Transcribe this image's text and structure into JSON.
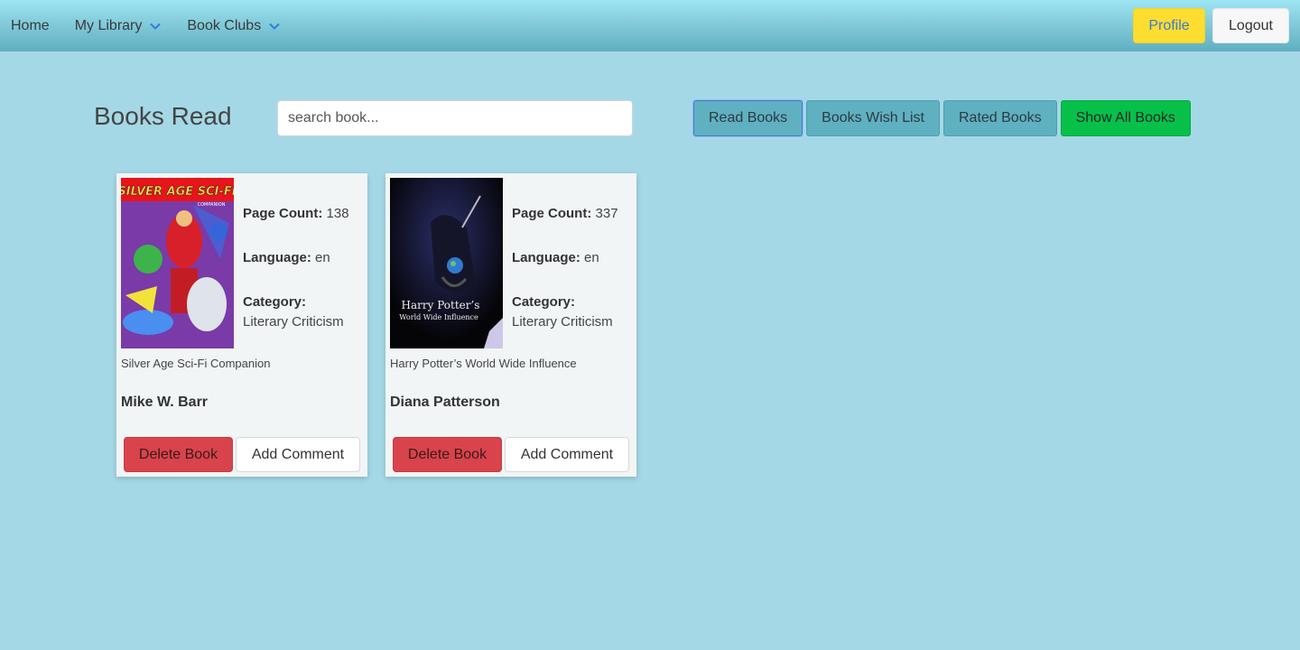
{
  "nav": {
    "home": "Home",
    "my_library": "My Library",
    "book_clubs": "Book Clubs",
    "profile": "Profile",
    "logout": "Logout"
  },
  "page": {
    "title": "Books Read",
    "search_placeholder": "search book..."
  },
  "filters": [
    {
      "label": "Read Books",
      "active": true
    },
    {
      "label": "Books Wish List",
      "active": false
    },
    {
      "label": "Rated Books",
      "active": false
    },
    {
      "label": "Show All Books",
      "active": false
    }
  ],
  "labels": {
    "page_count": "Page Count:",
    "language": "Language:",
    "category": "Category:",
    "delete": "Delete Book",
    "comment": "Add Comment"
  },
  "books": [
    {
      "page_count": "138",
      "language": "en",
      "category": "Literary Criticism",
      "title": "Silver Age Sci-Fi Companion",
      "author": "Mike W. Barr",
      "cover_text": "SILVER AGE SCI-FI",
      "cover_subtext": "COMPANION"
    },
    {
      "page_count": "337",
      "language": "en",
      "category": "Literary Criticism",
      "title": "Harry Potter’s World Wide Influence",
      "author": "Diana Patterson",
      "cover_text": "Harry Potter’s",
      "cover_subtext": "World Wide Influence"
    }
  ],
  "colors": {
    "background": "#a5d8e6",
    "profile_button": "#fddd2f",
    "show_all_button": "#07c04a",
    "delete_button": "#d9434b"
  }
}
